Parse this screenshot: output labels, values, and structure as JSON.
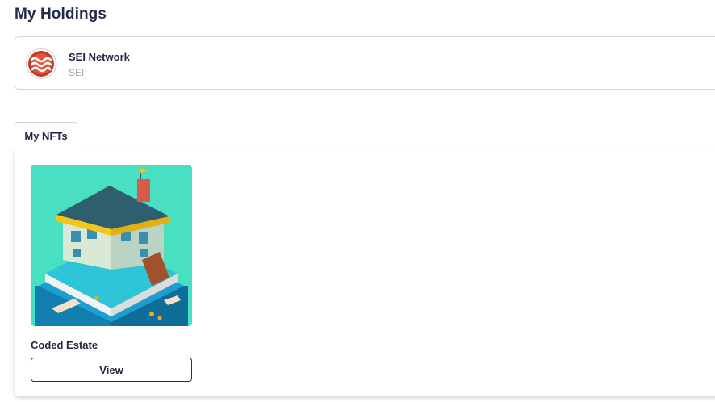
{
  "page": {
    "title": "My Holdings"
  },
  "holdings": [
    {
      "name": "SEI Network",
      "symbol": "SEI",
      "logo_icon": "sei-logo-icon",
      "logo_color": "#c0392b"
    }
  ],
  "tabs": [
    {
      "label": "My NFTs",
      "active": true
    }
  ],
  "nfts": [
    {
      "name": "Coded Estate",
      "image_icon": "isometric-estate-image",
      "action_label": "View"
    }
  ],
  "colors": {
    "text": "#1f2544",
    "muted": "#a4a6b3",
    "border": "#d6d6d9",
    "nft_background": "#48e0c0"
  }
}
